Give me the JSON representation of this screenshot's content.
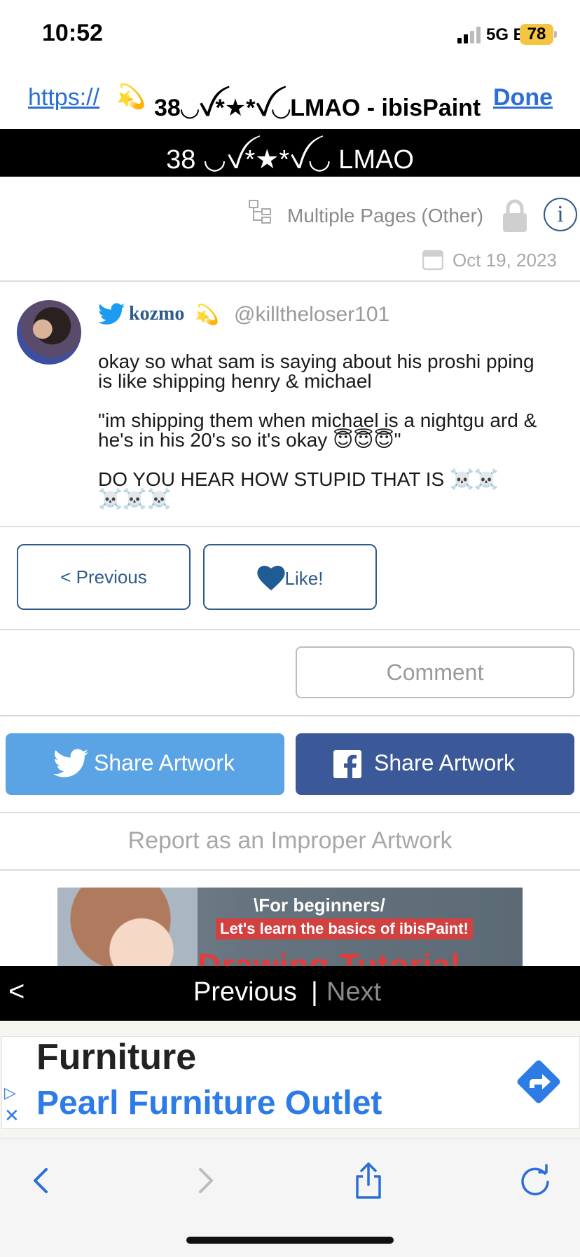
{
  "status": {
    "time": "10:52",
    "network": "5G E",
    "battery": "78"
  },
  "browser": {
    "url_scheme": "https://",
    "tab_emoji": "💫",
    "page_title": "38◡ꪜ*★*ꪜ◡LMAO - ibisPaint",
    "done_label": "Done"
  },
  "artwork": {
    "title": "38 ◡ꪜ*★*ꪜ◡ LMAO",
    "category": "Multiple Pages (Other)",
    "date": "Oct 19, 2023"
  },
  "post": {
    "author": "kozmo",
    "author_emoji": "💫",
    "handle": "@killtheloser101",
    "paragraphs": [
      "okay so what sam is saying about his proshi pping is like shipping henry & michael",
      "\"im shipping them when michael is a nightgu ard & he's in his 20's so it's okay 😇😇😇\"",
      "DO YOU HEAR HOW STUPID THAT IS ☠️☠️ ☠️☠️☠️"
    ]
  },
  "actions": {
    "previous_label": "< Previous",
    "like_label": "Like!",
    "comment_label": "Comment",
    "share_twitter_label": "Share Artwork",
    "share_facebook_label": "Share Artwork",
    "report_label": "Report as an Improper Artwork"
  },
  "banner": {
    "line1": "\\For beginners/",
    "line2": "Let's learn the basics of ibisPaint!",
    "line3": "Drawing Tutorial"
  },
  "nav": {
    "back": "<",
    "previous": "Previous",
    "separator": "|",
    "next": "Next"
  },
  "ad": {
    "title": "Furniture",
    "advertiser": "Pearl Furniture Outlet"
  },
  "colors": {
    "link": "#2b6fd6",
    "accent": "#2e5b8c",
    "twitter": "#5aa3e4",
    "facebook": "#3b5998",
    "battery": "#f4c542"
  }
}
